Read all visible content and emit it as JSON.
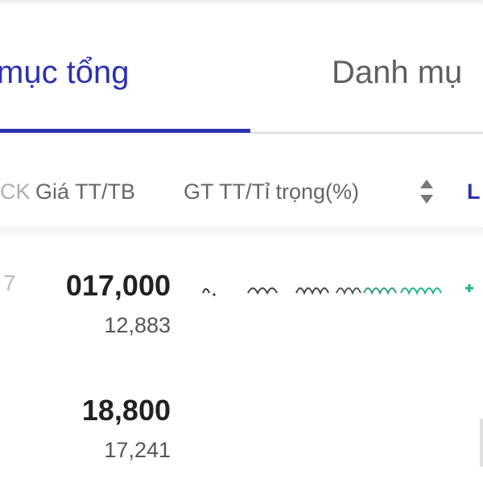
{
  "tabs": {
    "active_label": "mục tổng",
    "inactive_label": "Danh mụ"
  },
  "table": {
    "headers": {
      "cutoff": "CK",
      "price": "Giá TT/TB",
      "value": "GT TT/Tỉ trọng(%)",
      "next": "L"
    },
    "rows": [
      {
        "price": "017,000",
        "avg_price": "12,883",
        "edge": "7"
      },
      {
        "price": "18,800",
        "avg_price": "17,241",
        "edge": ""
      }
    ]
  },
  "colors": {
    "accent": "#2b32b2",
    "positive": "#1fb58a"
  },
  "icons": [
    "sort-icon"
  ]
}
